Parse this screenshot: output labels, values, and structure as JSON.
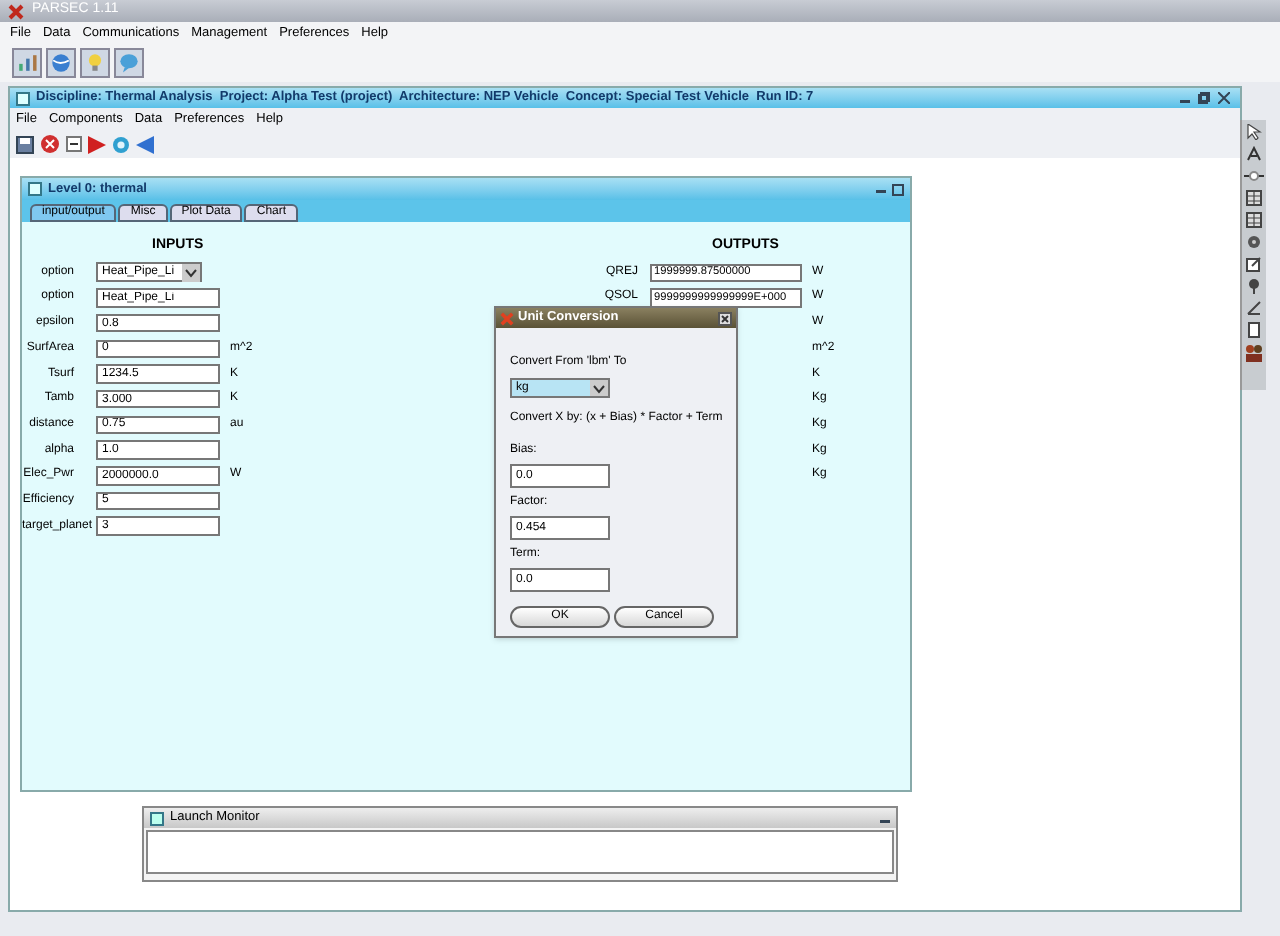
{
  "app": {
    "title": "PARSEC 1.11",
    "menu": [
      "File",
      "Data",
      "Communications",
      "Management",
      "Preferences",
      "Help"
    ]
  },
  "project_window": {
    "title": "Discipline: Thermal Analysis  Project: Alpha Test (project)  Architecture: NEP Vehicle  Concept: Special Test Vehicle  Run ID: 7",
    "menu": [
      "File",
      "Components",
      "Data",
      "Preferences",
      "Help"
    ]
  },
  "level_window": {
    "title": "Level 0: thermal",
    "tabs": [
      {
        "label": "input/output",
        "selected": true
      },
      {
        "label": "Misc",
        "selected": false
      },
      {
        "label": "Plot Data",
        "selected": false
      },
      {
        "label": "Chart",
        "selected": false
      }
    ],
    "inputs": {
      "heading": "INPUTS",
      "rows": [
        {
          "kind": "dropdown",
          "label": "option",
          "value": "Heat_Pipe_Li"
        },
        {
          "kind": "text",
          "label": "option",
          "value": "Heat_Pipe_Li"
        },
        {
          "kind": "text",
          "label": "epsilon",
          "value": "0.8"
        },
        {
          "kind": "text",
          "label": "SurfArea",
          "value": "0",
          "unit": "m^2"
        },
        {
          "kind": "text",
          "label": "Tsurf",
          "value": "1234.5",
          "unit": "K"
        },
        {
          "kind": "text",
          "label": "Tamb",
          "value": "3.000",
          "unit": "K"
        },
        {
          "kind": "text",
          "label": "distance",
          "value": "0.75",
          "unit": "au"
        },
        {
          "kind": "text",
          "label": "alpha",
          "value": "1.0"
        },
        {
          "kind": "text",
          "label": "Elec_Pwr",
          "value": "2000000.0",
          "unit": "W"
        },
        {
          "kind": "text",
          "label": "Efficiency",
          "value": "5"
        },
        {
          "kind": "text",
          "label": "target_planet",
          "value": "3"
        }
      ]
    },
    "outputs": {
      "heading": "OUTPUTS",
      "rows": [
        {
          "label": "QREJ",
          "value": "1999999.87500000",
          "unit": "W"
        },
        {
          "label": "QSOL",
          "value": "9999999999999999E+000",
          "unit": "W"
        },
        {
          "unit": "W"
        },
        {
          "unit": "m^2"
        },
        {
          "unit": "K"
        },
        {
          "unit": "Kg"
        },
        {
          "unit": "Kg"
        },
        {
          "unit": "Kg"
        },
        {
          "unit": "Kg"
        }
      ]
    }
  },
  "dialog": {
    "title": "Unit Conversion",
    "from_label": "Convert From 'lbm' To",
    "to_unit": "kg",
    "formula": "Convert X by: (x + Bias) * Factor + Term",
    "fields": [
      {
        "label": "Bias:",
        "value": "0.0"
      },
      {
        "label": "Factor:",
        "value": "0.454"
      },
      {
        "label": "Term:",
        "value": "0.0"
      }
    ],
    "buttons": [
      "OK",
      "Cancel"
    ]
  },
  "launch_monitor": {
    "title": "Launch Monitor"
  }
}
